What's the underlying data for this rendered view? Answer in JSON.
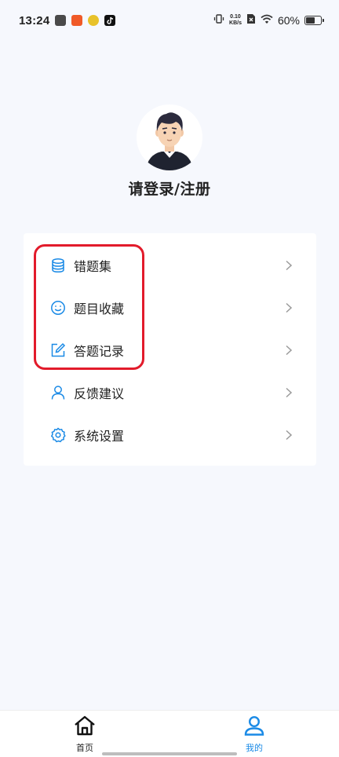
{
  "status_bar": {
    "time": "13:24",
    "net_speed_value": "0.10",
    "net_speed_unit": "KB/s",
    "battery_percent": "60%",
    "battery_level": 0.6
  },
  "profile": {
    "login_prompt": "请登录/注册"
  },
  "menu": {
    "items": [
      {
        "label": "错题集",
        "icon": "database-icon"
      },
      {
        "label": "题目收藏",
        "icon": "smiley-icon"
      },
      {
        "label": "答题记录",
        "icon": "edit-icon"
      },
      {
        "label": "反馈建议",
        "icon": "user-icon"
      },
      {
        "label": "系统设置",
        "icon": "gear-icon"
      }
    ]
  },
  "tab_bar": {
    "tabs": [
      {
        "label": "首页",
        "icon": "home-icon",
        "active": false
      },
      {
        "label": "我的",
        "icon": "user-icon",
        "active": true
      }
    ]
  },
  "colors": {
    "accent": "#1a8ae6",
    "highlight": "#e21b2b",
    "background": "#f6f8fd"
  }
}
